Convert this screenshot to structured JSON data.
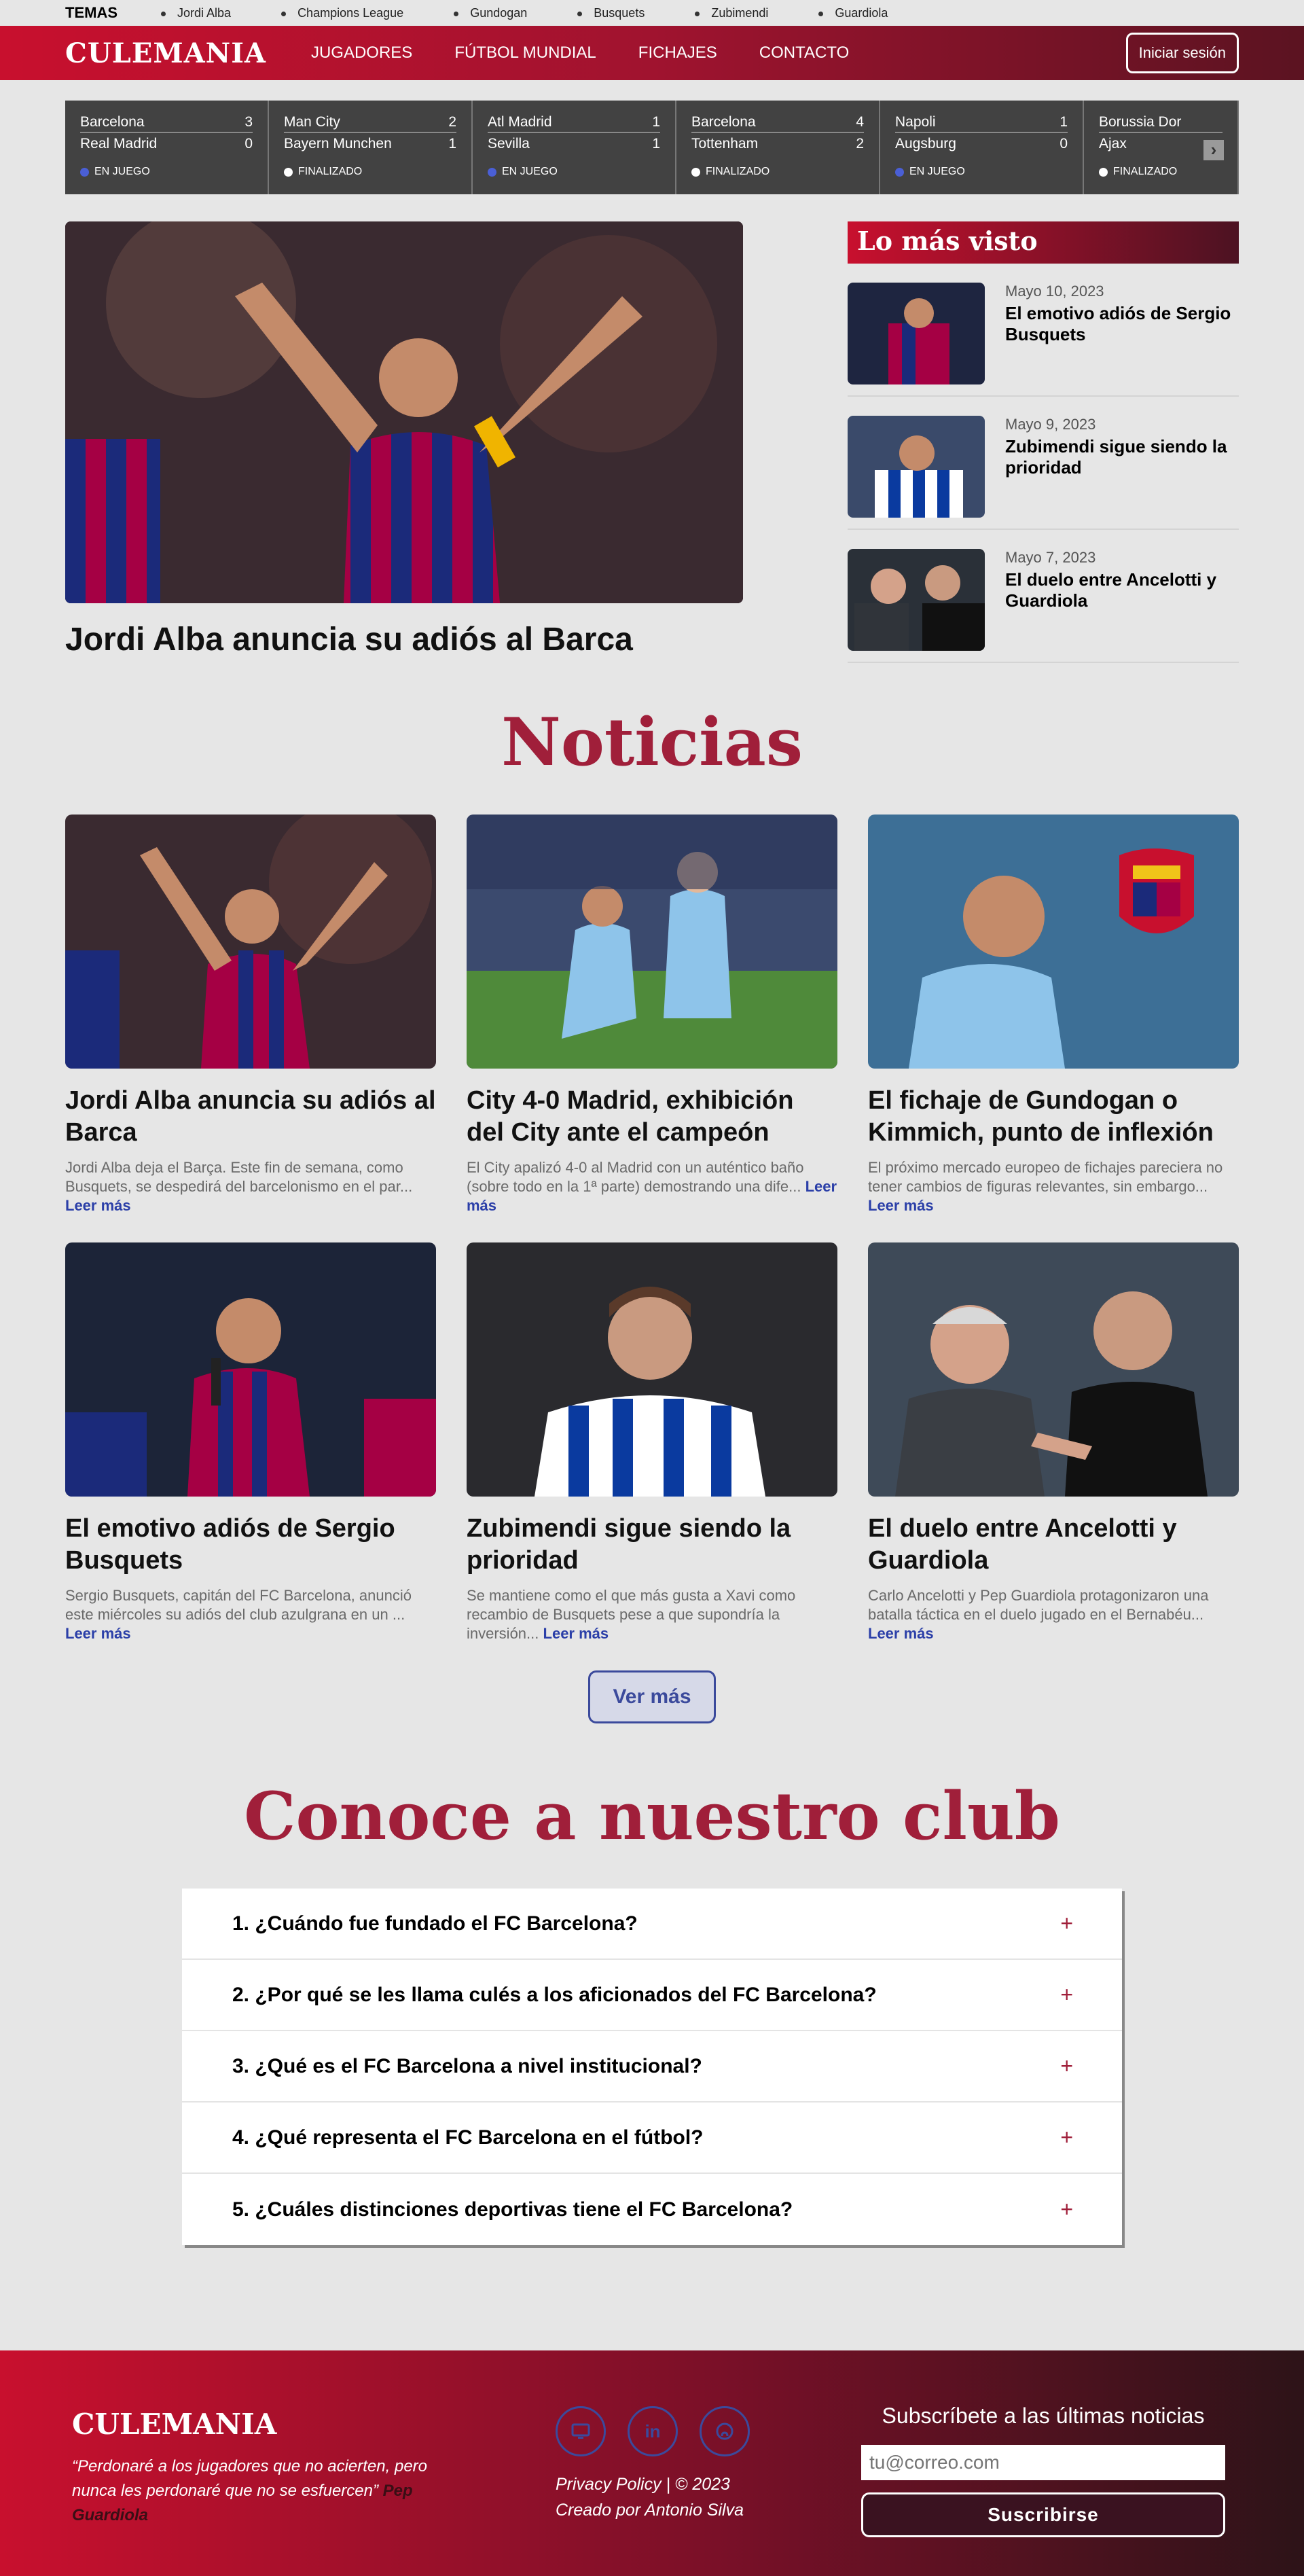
{
  "topics": {
    "label": "TEMAS",
    "items": [
      "Jordi Alba",
      "Champions League",
      "Gundogan",
      "Busquets",
      "Zubimendi",
      "Guardiola"
    ]
  },
  "nav": {
    "logo": "CULEMANIA",
    "links": [
      "JUGADORES",
      "FÚTBOL MUNDIAL",
      "FICHAJES",
      "CONTACTO"
    ],
    "login": "Iniciar sesión"
  },
  "scores": [
    {
      "home": "Barcelona",
      "home_score": "3",
      "away": "Real Madrid",
      "away_score": "0",
      "status": "EN JUEGO",
      "live": true
    },
    {
      "home": "Man City",
      "home_score": "2",
      "away": "Bayern Munchen",
      "away_score": "1",
      "status": "FINALIZADO",
      "live": false
    },
    {
      "home": "Atl Madrid",
      "home_score": "1",
      "away": "Sevilla",
      "away_score": "1",
      "status": "EN JUEGO",
      "live": true
    },
    {
      "home": "Barcelona",
      "home_score": "4",
      "away": "Tottenham",
      "away_score": "2",
      "status": "FINALIZADO",
      "live": false
    },
    {
      "home": "Napoli",
      "home_score": "1",
      "away": "Augsburg",
      "away_score": "0",
      "status": "EN JUEGO",
      "live": true
    },
    {
      "home": "Borussia Dor",
      "home_score": "",
      "away": "Ajax",
      "away_score": "",
      "status": "FINALIZADO",
      "live": false
    }
  ],
  "hero": {
    "title": "Jordi Alba anuncia su adiós al Barca"
  },
  "most_viewed": {
    "heading": "Lo más visto",
    "items": [
      {
        "date": "Mayo 10, 2023",
        "title": "El emotivo adiós de Sergio Busquets"
      },
      {
        "date": "Mayo 9, 2023",
        "title": "Zubimendi sigue siendo la prioridad"
      },
      {
        "date": "Mayo 7, 2023",
        "title": "El duelo entre Ancelotti y Guardiola"
      }
    ]
  },
  "news": {
    "heading": "Noticias",
    "read_more": "Leer más",
    "cards": [
      {
        "title": "Jordi Alba anuncia su adiós al Barca",
        "text": "Jordi Alba deja el Barça. Este fin de semana, como Busquets, se despedirá del barcelonismo en el par..."
      },
      {
        "title": "City 4-0 Madrid, exhibición del City ante el campeón",
        "text": "El City apalizó 4-0 al Madrid con un auténtico baño (sobre todo en la 1ª parte) demostrando una dife..."
      },
      {
        "title": "El fichaje de Gundogan o Kimmich, punto de inflexión",
        "text": "El próximo mercado europeo de fichajes pareciera no tener cambios de figuras relevantes, sin embargo..."
      },
      {
        "title": "El emotivo adiós de Sergio Busquets",
        "text": "Sergio Busquets, capitán del FC Barcelona, anunció este miércoles su adiós del club azulgrana en un ..."
      },
      {
        "title": "Zubimendi sigue siendo la prioridad",
        "text": "Se mantiene como el que más gusta a Xavi como recambio de Busquets pese a que supondría la inversión..."
      },
      {
        "title": "El duelo entre Ancelotti y Guardiola",
        "text": "Carlo Ancelotti y Pep Guardiola protagonizaron una batalla táctica en el duelo jugado en el Bernabéu..."
      }
    ],
    "more_button": "Ver más"
  },
  "club": {
    "heading": "Conoce a nuestro club",
    "faq": [
      "1. ¿Cuándo fue fundado el FC Barcelona?",
      "2. ¿Por qué se les llama culés a los aficionados del FC Barcelona?",
      "3. ¿Qué es el FC Barcelona a nivel institucional?",
      "4. ¿Qué representa el FC Barcelona en el fútbol?",
      "5. ¿Cuáles distinciones deportivas tiene el FC Barcelona?"
    ]
  },
  "footer": {
    "logo": "CULEMANIA",
    "quote": "“Perdonaré a los jugadores que no acierten, pero nunca les perdonaré que no se esfuercen”",
    "quote_author": "Pep Guardiola",
    "legal": "Privacy Policy | © 2023",
    "credit": "Creado por Antonio Silva",
    "subscribe_heading": "Subscríbete a las últimas noticias",
    "email_placeholder": "tu@correo.com",
    "subscribe_button": "Suscribirse",
    "socials": [
      "monitor-icon",
      "linkedin-icon",
      "github-icon"
    ]
  },
  "colors": {
    "brand": "#c8102e",
    "title": "#a01f3a",
    "link": "#2b3fa8",
    "live_dot": "#4a5fd6"
  }
}
